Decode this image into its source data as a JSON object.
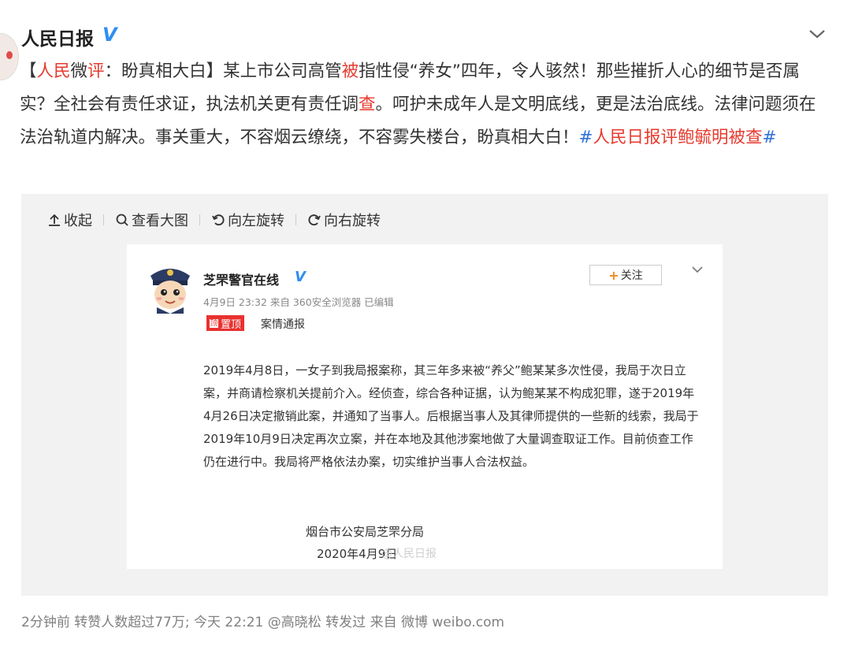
{
  "post": {
    "author": "人民日报",
    "verified_badge": "V",
    "text": {
      "l1": "【",
      "l2": "人民",
      "l3": "微",
      "l4": "评",
      "l5": "：盼真相大白】某上市公司高管",
      "l6": "被",
      "l7": "指性侵“养女”四年，令人骇然！那些摧折人心的细节是否属实？全社会有责任求证，执法机关更有责任调",
      "l8": "查",
      "l9": "。呵护未成年人是文明底线，更是法治底线。法律问题须在法治轨道内解决。事关重大，不容烟云缭绕，不容雾失楼台，盼真相大白！",
      "hashtag_open": "#",
      "hashtag_text": "人民日报评鲍毓明被查",
      "hashtag_close": "#"
    }
  },
  "toolbar": {
    "collapse": "收起",
    "view_large": "查看大图",
    "rotate_left": "向左旋转",
    "rotate_right": "向右旋转"
  },
  "embedded": {
    "account_name": "芝罘警官在线",
    "verified_badge": "V",
    "meta": "4月9日 23:32 来自 360安全浏览器 已编辑",
    "follow_label": "关注",
    "follow_plus": "+",
    "tag_label": "置顶",
    "tag_icon": "顶",
    "tag_text": "案情通报",
    "notice": "2019年4月8日，一女子到我局报案称，其三年多来被“养父”鲍某某多次性侵，我局于次日立案，并商请检察机关提前介入。经侦查，综合各种证据，认为鲍某某不构成犯罪，遂于2019年4月26日决定撤销此案，并通知了当事人。后根据当事人及其律师提供的一些新的线索，我局于2019年10月9日决定再次立案，并在本地及其他涉案地做了大量调查取证工作。目前侦查工作仍在进行中。我局将严格依法办案，切实维护当事人合法权益。",
    "sign_org": "烟台市公安局芝罘分局",
    "sign_date": "2020年4月9日",
    "watermark": "@人民日报"
  },
  "footer": {
    "text": "2分钟前 转赞人数超过77万; 今天 22:21 @高晓松 转发过  来自 微博 weibo.com"
  },
  "icons": {
    "menu": "chevron-down-icon",
    "collapse": "arrow-up-icon",
    "view_large": "search-icon",
    "rotate_left": "rotate-left-icon",
    "rotate_right": "rotate-right-icon",
    "avatar": "police-officer-avatar"
  },
  "colors": {
    "highlight_red": "#e63a2e",
    "link_blue": "#3272d8",
    "verified_blue": "#2f8ef2",
    "tag_red": "#e8322f",
    "follow_plus_orange": "#f08a24"
  }
}
